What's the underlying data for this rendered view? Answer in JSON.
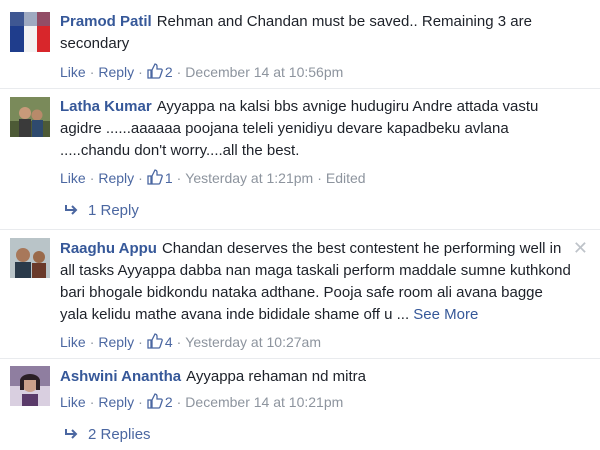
{
  "comments": [
    {
      "author": "Pramod Patil",
      "text": "Rehman and Chandan must be saved.. Remaining 3 are secondary",
      "like_label": "Like",
      "reply_label": "Reply",
      "like_count": "2",
      "timestamp": "December 14 at 10:56pm"
    },
    {
      "author": "Latha Kumar",
      "text": "Ayyappa na kalsi bbs avnige hudugiru Andre attada vastu agidre ......aaaaaa poojana teleli yenidiyu devare kapadbeku avlana .....chandu don't worry....all the best.",
      "like_label": "Like",
      "reply_label": "Reply",
      "like_count": "1",
      "timestamp": "Yesterday at 1:21pm",
      "edited": "Edited",
      "replies_label": "1 Reply"
    },
    {
      "author": "Raaghu Appu",
      "text": "Chandan deserves the best contestent he performing well in all tasks Ayyappa dabba nan maga taskali perform maddale sumne kuthkond bari bhogale bidkondu nataka adthane. Pooja safe room ali avana bagge yala kelidu mathe avana inde bididale shame off u ...",
      "see_more": "See More",
      "like_label": "Like",
      "reply_label": "Reply",
      "like_count": "4",
      "timestamp": "Yesterday at 10:27am"
    },
    {
      "author": "Ashwini Anantha",
      "text": "Ayyappa rehaman nd mitra",
      "like_label": "Like",
      "reply_label": "Reply",
      "like_count": "2",
      "timestamp": "December 14 at 10:21pm",
      "replies_label": "2 Replies"
    }
  ],
  "separator": "·",
  "close_symbol": "✕",
  "colors": {
    "link": "#365899",
    "action": "#4b67a1",
    "meta": "#8d949e"
  }
}
